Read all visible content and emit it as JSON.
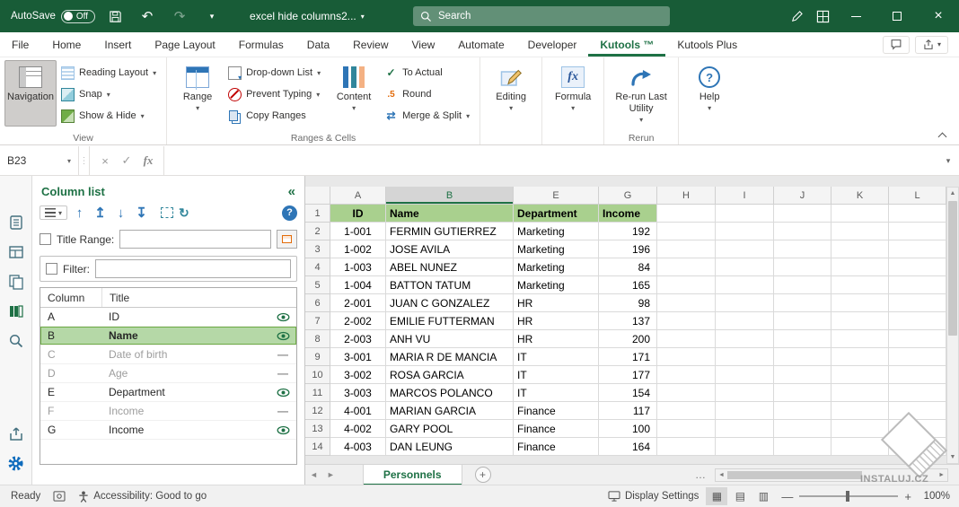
{
  "titlebar": {
    "autosave_label": "AutoSave",
    "autosave_state": "Off",
    "doc_title": "excel hide columns2...",
    "search_placeholder": "Search"
  },
  "tabs": {
    "active": "Kutools ™",
    "items": [
      "File",
      "Home",
      "Insert",
      "Page Layout",
      "Formulas",
      "Data",
      "Review",
      "View",
      "Automate",
      "Developer",
      "Kutools ™",
      "Kutools Plus"
    ]
  },
  "ribbon": {
    "navigation": "Navigation",
    "reading_layout": "Reading Layout",
    "snap": "Snap",
    "show_hide": "Show & Hide",
    "range": "Range",
    "dropdown_list": "Drop-down List",
    "prevent_typing": "Prevent Typing",
    "copy_ranges": "Copy Ranges",
    "content": "Content",
    "to_actual": "To Actual",
    "round": "Round",
    "merge_split": "Merge & Split",
    "editing": "Editing",
    "formula": "Formula",
    "rerun_last_utility": "Re-run Last Utility",
    "help": "Help",
    "group_view": "View",
    "group_ranges_cells": "Ranges & Cells",
    "group_rerun": "Rerun"
  },
  "formula_bar": {
    "name_box": "B23"
  },
  "pane": {
    "title": "Column list",
    "collapse_icon": "«",
    "title_range_label": "Title Range:",
    "filter_label": "Filter:",
    "table_headers": {
      "column": "Column",
      "title": "Title"
    },
    "rows": [
      {
        "col": "A",
        "title": "ID",
        "state": "visible",
        "selected": false
      },
      {
        "col": "B",
        "title": "Name",
        "state": "visible",
        "selected": true
      },
      {
        "col": "C",
        "title": "Date of birth",
        "state": "hidden",
        "selected": false
      },
      {
        "col": "D",
        "title": "Age",
        "state": "hidden",
        "selected": false
      },
      {
        "col": "E",
        "title": "Department",
        "state": "visible",
        "selected": false
      },
      {
        "col": "F",
        "title": "Income",
        "state": "hidden",
        "selected": false
      },
      {
        "col": "G",
        "title": "Income",
        "state": "visible",
        "selected": false
      }
    ]
  },
  "sheet": {
    "columns": [
      "A",
      "B",
      "E",
      "G",
      "H",
      "I",
      "J",
      "K",
      "L"
    ],
    "selected_column": "B",
    "header_cells": [
      "ID",
      "Name",
      "Department",
      "Income"
    ],
    "rows": [
      [
        "1-001",
        "FERMIN GUTIERREZ",
        "Marketing",
        "192"
      ],
      [
        "1-002",
        "JOSE AVILA",
        "Marketing",
        "196"
      ],
      [
        "1-003",
        "ABEL NUNEZ",
        "Marketing",
        "84"
      ],
      [
        "1-004",
        "BATTON TATUM",
        "Marketing",
        "165"
      ],
      [
        "2-001",
        "JUAN C GONZALEZ",
        "HR",
        "98"
      ],
      [
        "2-002",
        "EMILIE FUTTERMAN",
        "HR",
        "137"
      ],
      [
        "2-003",
        "ANH VU",
        "HR",
        "200"
      ],
      [
        "3-001",
        "MARIA R DE MANCIA",
        "IT",
        "171"
      ],
      [
        "3-002",
        "ROSA GARCIA",
        "IT",
        "177"
      ],
      [
        "3-003",
        "MARCOS POLANCO",
        "IT",
        "154"
      ],
      [
        "4-001",
        "MARIAN GARCIA",
        "Finance",
        "117"
      ],
      [
        "4-002",
        "GARY POOL",
        "Finance",
        "100"
      ],
      [
        "4-003",
        "DAN LEUNG",
        "Finance",
        "164"
      ]
    ],
    "tab_name": "Personnels"
  },
  "status": {
    "ready": "Ready",
    "accessibility": "Accessibility: Good to go",
    "display_settings": "Display Settings",
    "zoom_level": "100%"
  },
  "watermark": {
    "text": "INSTALUJ.CZ"
  },
  "colors": {
    "accent_green": "#1e7145",
    "header_fill": "#a9d08e",
    "titlebar_green": "#185c37"
  }
}
